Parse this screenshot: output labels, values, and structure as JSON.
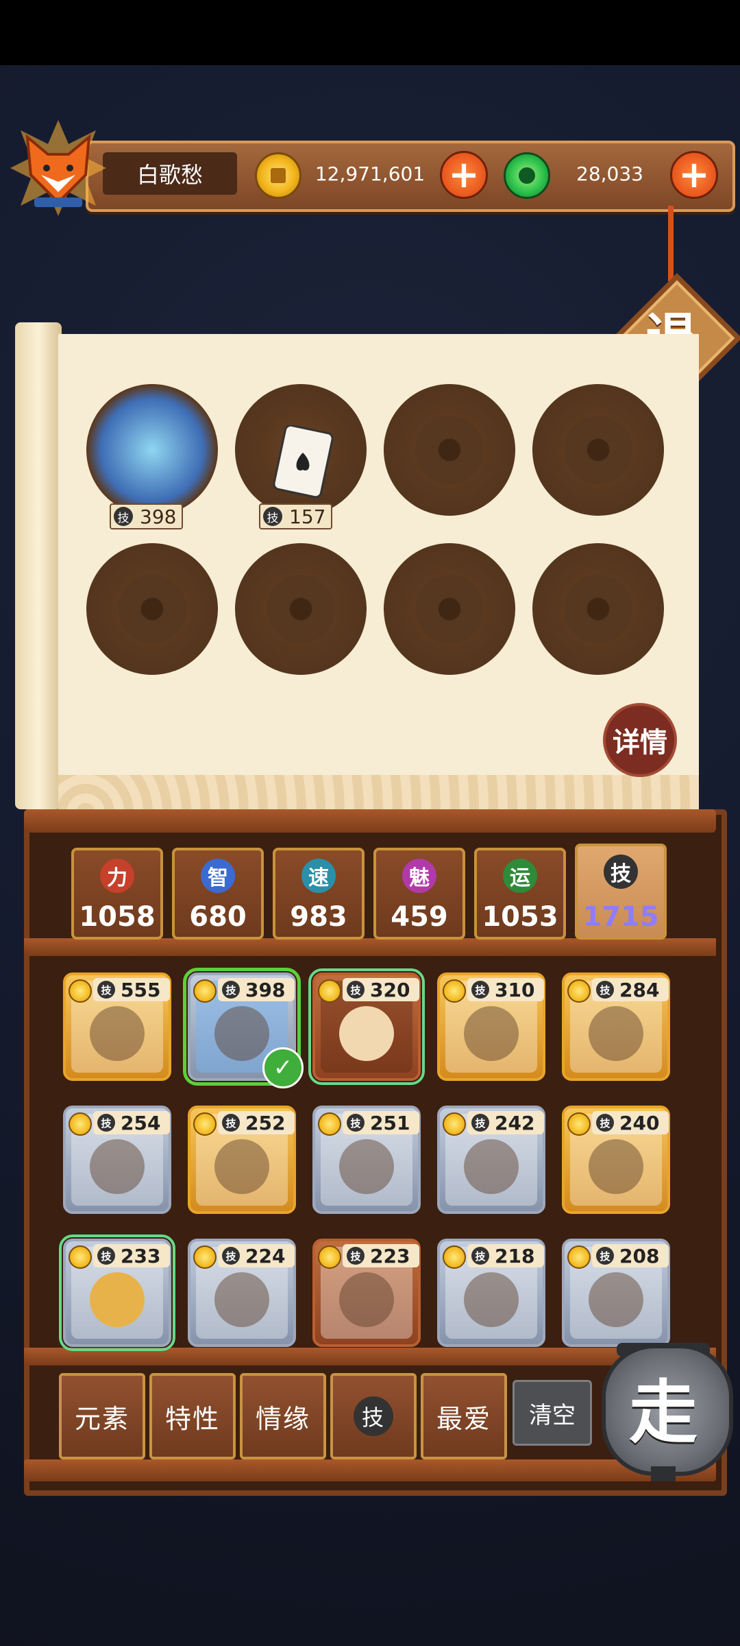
{
  "player": {
    "name": "白歌愁"
  },
  "currency": {
    "gold": "12,971,601",
    "jade": "28,033"
  },
  "exit_label": "退",
  "detail_label": "详情",
  "skill_icon_char": "技",
  "slots": [
    {
      "value": "398"
    },
    {
      "value": "157"
    }
  ],
  "stats": [
    {
      "icon": "力",
      "value": "1058",
      "color": "#c6402c"
    },
    {
      "icon": "智",
      "value": "680",
      "color": "#3b6bd1"
    },
    {
      "icon": "速",
      "value": "983",
      "color": "#2a8fa8"
    },
    {
      "icon": "魅",
      "value": "459",
      "color": "#b13aa8"
    },
    {
      "icon": "运",
      "value": "1053",
      "color": "#2f8a3a"
    },
    {
      "icon": "技",
      "value": "1715",
      "color": "#333333"
    }
  ],
  "cards": [
    {
      "value": "555"
    },
    {
      "value": "398"
    },
    {
      "value": "320"
    },
    {
      "value": "310"
    },
    {
      "value": "284"
    },
    {
      "value": "254"
    },
    {
      "value": "252"
    },
    {
      "value": "251"
    },
    {
      "value": "242"
    },
    {
      "value": "240"
    },
    {
      "value": "233"
    },
    {
      "value": "224"
    },
    {
      "value": "223"
    },
    {
      "value": "218"
    },
    {
      "value": "208"
    }
  ],
  "filters": {
    "element": "元素",
    "trait": "特性",
    "bond": "情缘",
    "favorite": "最爱",
    "clear": "清空"
  },
  "go_label": "走"
}
